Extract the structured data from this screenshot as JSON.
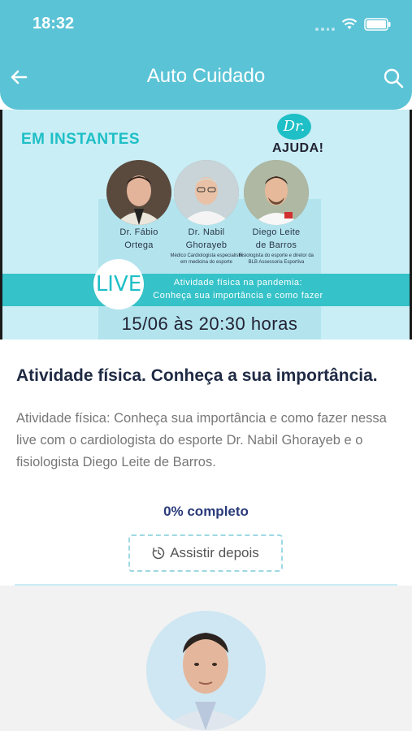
{
  "status_bar": {
    "time": "18:32"
  },
  "header": {
    "title": "Auto Cuidado",
    "back_icon": "arrow-left-icon",
    "search_icon": "search-icon"
  },
  "banner": {
    "tag": "EM INSTANTES",
    "logo_dr": "Dr.",
    "logo_ajuda": "AJUDA!",
    "doctors": [
      {
        "name_line1": "Dr. Fábio",
        "name_line2": "Ortega",
        "role": ""
      },
      {
        "name_line1": "Dr. Nabil",
        "name_line2": "Ghorayeb",
        "role": "Médico Cardiologista especialista em medicina do esporte"
      },
      {
        "name_line1": "Diego Leite",
        "name_line2": "de Barros",
        "role": "Fisiologista do esporte e diretor da BLB Assessoria Esportiva"
      }
    ],
    "live_label": "LIVE",
    "strip_line1": "Atividade física na pandemia:",
    "strip_line2": "Conheça sua importância e como fazer",
    "datetime": "15/06 às 20:30 horas"
  },
  "content": {
    "title": "Atividade física. Conheça a sua importância.",
    "description": "Atividade física: Conheça sua importância e como fazer nessa live com o cardiologista do esporte Dr. Nabil Ghorayeb e o fisiologista Diego Leite de Barros.",
    "progress": "0% completo",
    "progress_value": 0,
    "watch_later_label": "Assistir depois",
    "watch_later_icon": "timer-icon"
  },
  "colors": {
    "accent": "#5bc3d6",
    "title_text": "#1f2a44",
    "progress_text": "#2a3b7a"
  }
}
